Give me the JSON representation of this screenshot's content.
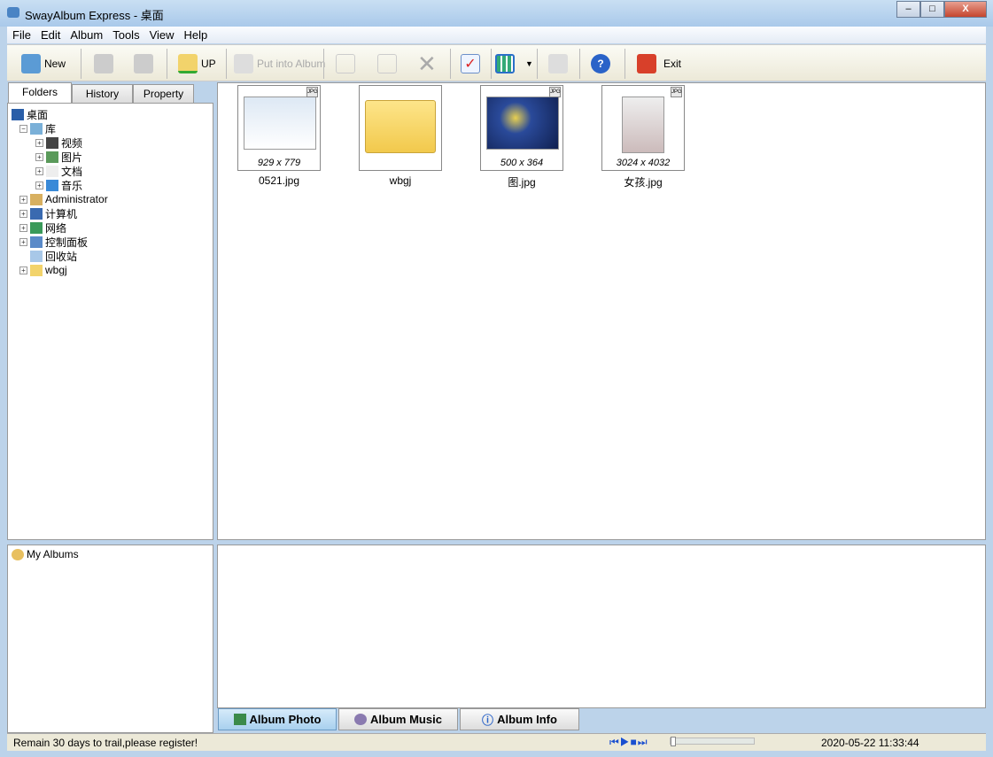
{
  "window": {
    "title": "SwayAlbum Express - 桌面",
    "minimize": "–",
    "maximize": "□",
    "close": "X"
  },
  "menu": [
    "File",
    "Edit",
    "Album",
    "Tools",
    "View",
    "Help"
  ],
  "toolbar": {
    "new": "New",
    "up": "UP",
    "put_into_album": "Put into Album",
    "exit": "Exit"
  },
  "left_tabs": [
    "Folders",
    "History",
    "Property"
  ],
  "tree": [
    {
      "label": "桌面",
      "level": 0,
      "icon": "desktop-icon",
      "exp": ""
    },
    {
      "label": "库",
      "level": 1,
      "icon": "library-icon",
      "exp": "−"
    },
    {
      "label": "视频",
      "level": 2,
      "icon": "video-icon",
      "exp": "+"
    },
    {
      "label": "图片",
      "level": 2,
      "icon": "pictures-icon",
      "exp": "+"
    },
    {
      "label": "文档",
      "level": 2,
      "icon": "documents-icon",
      "exp": "+"
    },
    {
      "label": "音乐",
      "level": 2,
      "icon": "music-icon",
      "exp": "+"
    },
    {
      "label": "Administrator",
      "level": 1,
      "icon": "user-icon",
      "exp": "+"
    },
    {
      "label": "计算机",
      "level": 1,
      "icon": "computer-icon",
      "exp": "+"
    },
    {
      "label": "网络",
      "level": 1,
      "icon": "network-icon",
      "exp": "+"
    },
    {
      "label": "控制面板",
      "level": 1,
      "icon": "control-panel-icon",
      "exp": "+"
    },
    {
      "label": "回收站",
      "level": 1,
      "icon": "recycle-bin-icon",
      "exp": ""
    },
    {
      "label": "wbgj",
      "level": 1,
      "icon": "folder-icon",
      "exp": "+"
    }
  ],
  "albums": {
    "label": "My Albums"
  },
  "files": [
    {
      "name": "0521.jpg",
      "dims": "929 x 779",
      "type": "image"
    },
    {
      "name": "wbgj",
      "dims": "",
      "type": "folder"
    },
    {
      "name": "图.jpg",
      "dims": "500 x 364",
      "type": "image"
    },
    {
      "name": "女孩.jpg",
      "dims": "3024 x 4032",
      "type": "image"
    }
  ],
  "bottom_tabs": [
    "Album Photo",
    "Album Music",
    "Album Info"
  ],
  "status": {
    "message": "Remain 30 days to trail,please register!",
    "datetime": "2020-05-22 11:33:44",
    "progress": 0
  }
}
